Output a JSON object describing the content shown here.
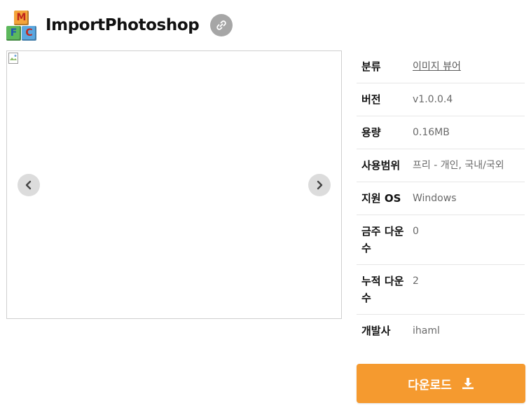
{
  "app": {
    "title": "ImportPhotoshop",
    "logo_letters": [
      "M",
      "F",
      "C"
    ]
  },
  "icons": {
    "link": "link-icon",
    "prev": "chevron-left-icon",
    "next": "chevron-right-icon",
    "download": "download-icon",
    "broken_image": "broken-image-icon"
  },
  "info": {
    "category": {
      "label": "분류",
      "value": "이미지 뷰어"
    },
    "version": {
      "label": "버전",
      "value": "v1.0.0.4"
    },
    "size": {
      "label": "용량",
      "value": "0.16MB"
    },
    "license": {
      "label": "사용범위",
      "value": "프리 - 개인, 국내/국외"
    },
    "os": {
      "label": "지원 OS",
      "value": "Windows"
    },
    "weekly_downloads": {
      "label": "금주 다운수",
      "value": "0"
    },
    "total_downloads": {
      "label": "누적 다운수",
      "value": "2"
    },
    "developer": {
      "label": "개발사",
      "value": "ihaml"
    }
  },
  "download": {
    "label": "다운로드"
  },
  "colors": {
    "accent": "#f59a2f",
    "link_button_bg": "#a6a6a6",
    "nav_button_bg": "#dcdcdc",
    "value_text": "#6a6a6a"
  }
}
